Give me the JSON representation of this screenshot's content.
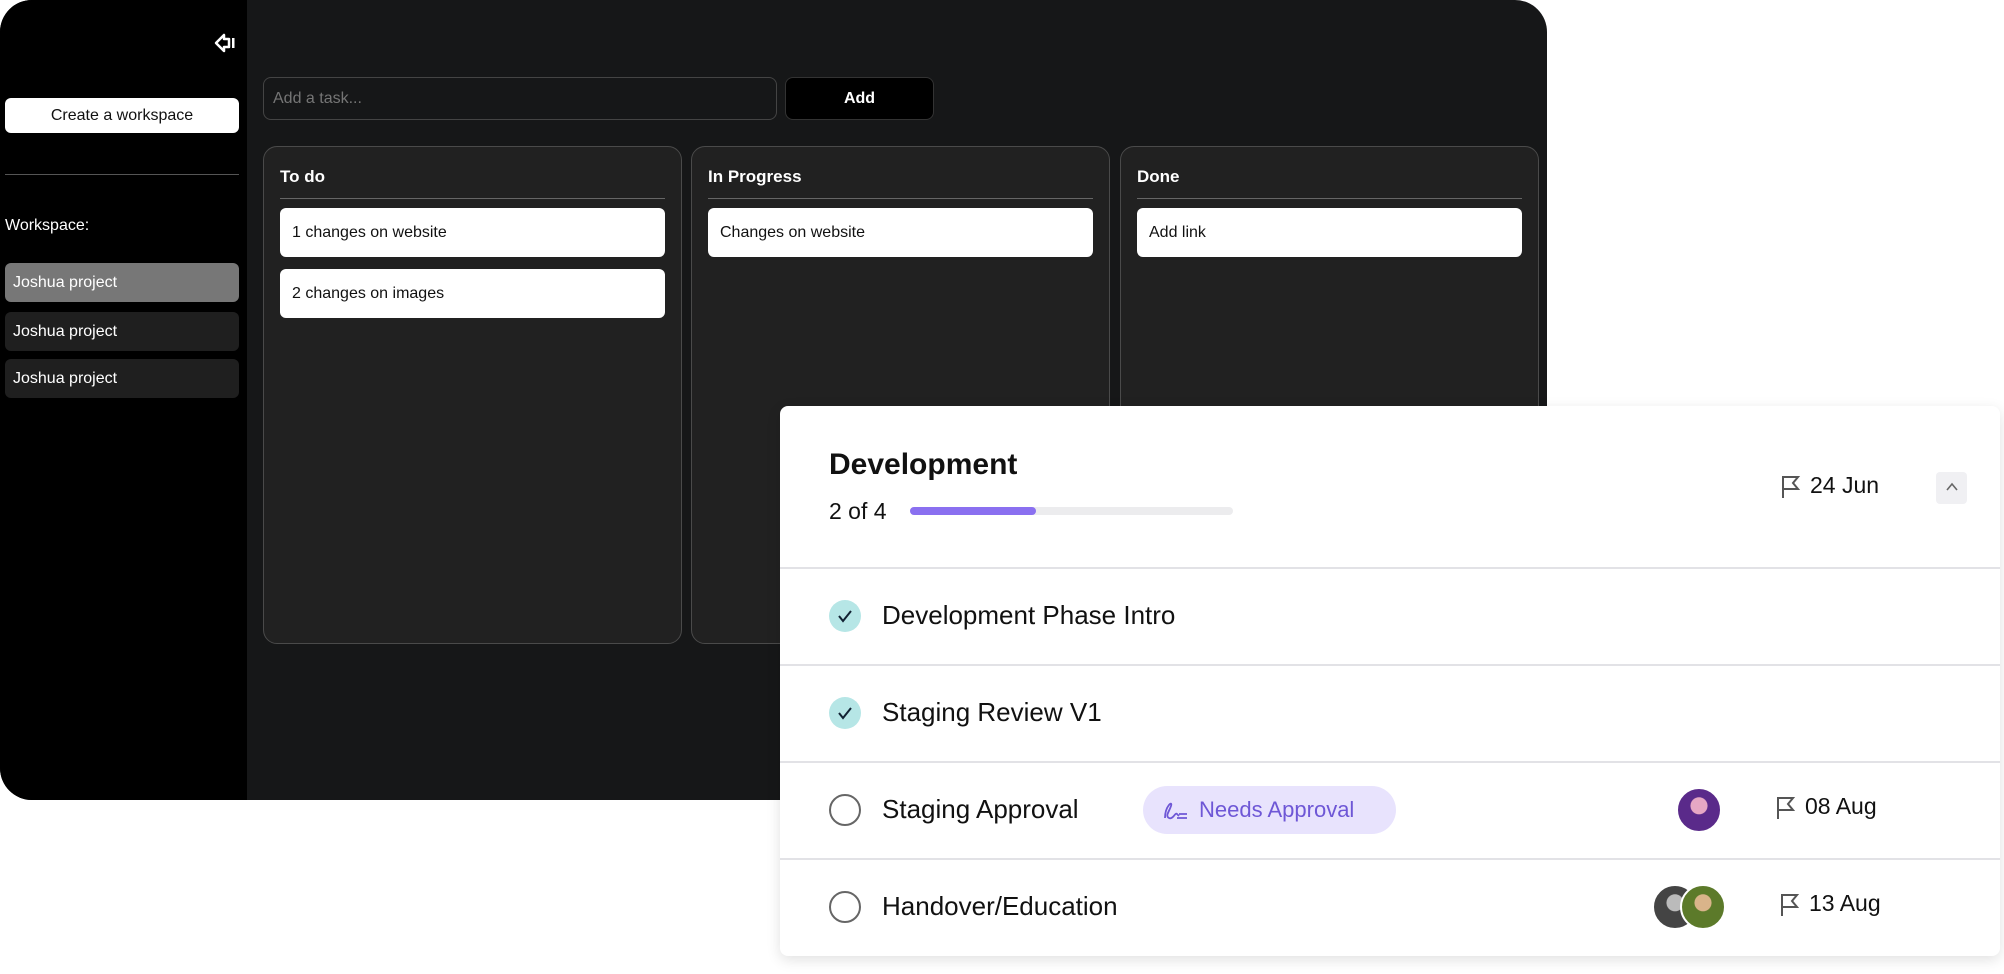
{
  "sidebar": {
    "create_label": "Create a workspace",
    "workspace_label": "Workspace:",
    "items": [
      {
        "label": "Joshua project",
        "active": true
      },
      {
        "label": "Joshua project"
      },
      {
        "label": "Joshua project"
      }
    ]
  },
  "toolbar": {
    "input_placeholder": "Add a task...",
    "add_label": "Add"
  },
  "columns": [
    {
      "title": "To do",
      "cards": [
        "1 changes on website",
        "2 changes on images"
      ]
    },
    {
      "title": "In Progress",
      "cards": [
        "Changes on website"
      ]
    },
    {
      "title": "Done",
      "cards": [
        "Add link"
      ]
    }
  ],
  "panel": {
    "title": "Development",
    "count": "2 of 4",
    "progress": 0.39,
    "date": "24 Jun",
    "rows": [
      {
        "label": "Development Phase Intro",
        "done": true
      },
      {
        "label": "Staging Review V1",
        "done": true
      },
      {
        "label": "Staging Approval",
        "done": false,
        "badge": "Needs Approval",
        "date": "08 Aug"
      },
      {
        "label": "Handover/Education",
        "done": false,
        "date": "13 Aug"
      }
    ]
  },
  "colors": {
    "accent": "#8a70f0",
    "badge_bg": "#e8e3fd",
    "badge_text": "#6e57d6",
    "check": "#b6e6e6"
  }
}
